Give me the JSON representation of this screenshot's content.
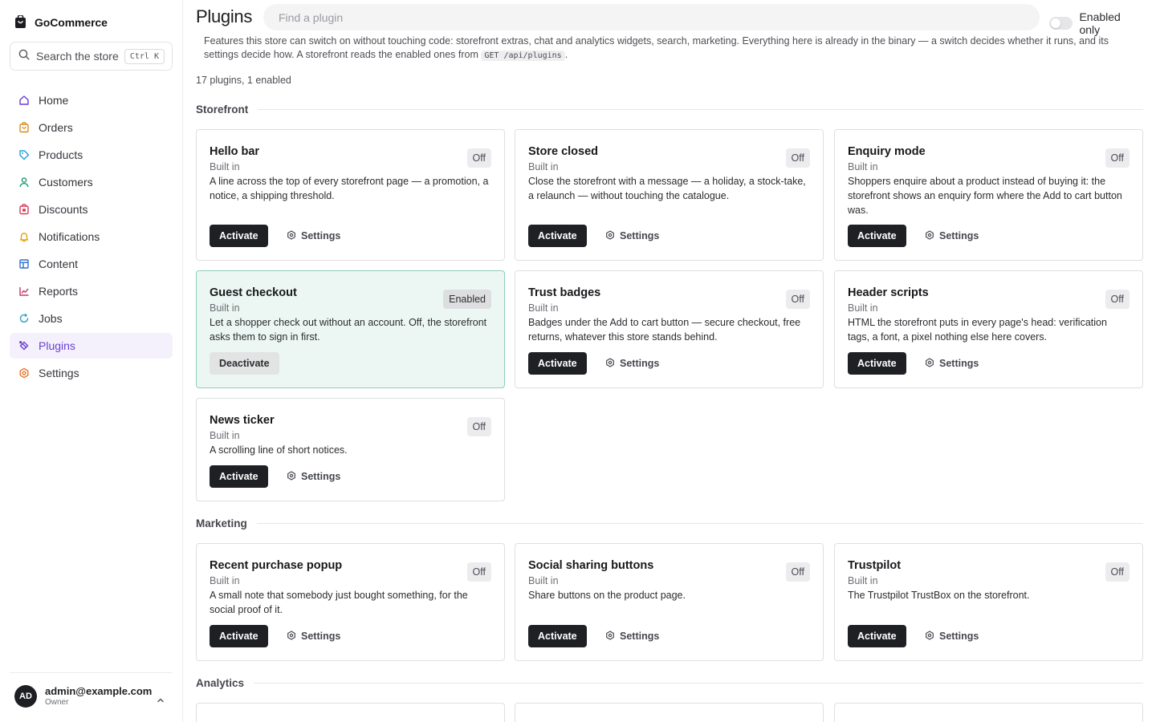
{
  "sidebar": {
    "brand": "GoCommerce",
    "search_label": "Search the store",
    "search_shortcut": "Ctrl K",
    "items": [
      {
        "label": "Home",
        "icon": "home-icon"
      },
      {
        "label": "Orders",
        "icon": "orders-icon"
      },
      {
        "label": "Products",
        "icon": "tag-icon"
      },
      {
        "label": "Customers",
        "icon": "user-icon"
      },
      {
        "label": "Discounts",
        "icon": "discount-icon"
      },
      {
        "label": "Notifications",
        "icon": "bell-icon"
      },
      {
        "label": "Content",
        "icon": "layout-icon"
      },
      {
        "label": "Reports",
        "icon": "chart-icon"
      },
      {
        "label": "Jobs",
        "icon": "refresh-icon"
      },
      {
        "label": "Plugins",
        "icon": "plug-icon",
        "active": true
      },
      {
        "label": "Settings",
        "icon": "gear-icon"
      }
    ],
    "user": {
      "initials": "AD",
      "email": "admin@example.com",
      "role": "Owner"
    }
  },
  "header": {
    "title": "Plugins",
    "search_placeholder": "Find a plugin",
    "toggle_label": "Enabled only",
    "toggle_on": false
  },
  "intro": {
    "text": "Features this store can switch on without touching code: storefront extras, chat and analytics widgets, search, marketing. Everything here is already in the binary — a switch decides whether it runs, and its settings decide how. A storefront reads the enabled ones from",
    "code": "GET /api/plugins",
    "end": "."
  },
  "count": "17 plugins, 1 enabled",
  "labels": {
    "built_in": "Built in",
    "off": "Off",
    "enabled": "Enabled",
    "activate": "Activate",
    "deactivate": "Deactivate",
    "settings": "Settings"
  },
  "colors": {
    "accent": "#6a3fd1",
    "enabled_bg": "#ecf7f3",
    "enabled_border": "#8fcfb9",
    "button_dark": "#1f2023"
  },
  "sections": [
    {
      "title": "Storefront",
      "plugins": [
        {
          "name": "Hello bar",
          "description": "A line across the top of every storefront page — a promotion, a notice, a shipping threshold.",
          "enabled": false
        },
        {
          "name": "Store closed",
          "description": "Close the storefront with a message — a holiday, a stock-take, a relaunch — without touching the catalogue.",
          "enabled": false
        },
        {
          "name": "Enquiry mode",
          "description": "Shoppers enquire about a product instead of buying it: the storefront shows an enquiry form where the Add to cart button was.",
          "enabled": false
        },
        {
          "name": "Guest checkout",
          "description": "Let a shopper check out without an account. Off, the storefront asks them to sign in first.",
          "enabled": true
        },
        {
          "name": "Trust badges",
          "description": "Badges under the Add to cart button — secure checkout, free returns, whatever this store stands behind.",
          "enabled": false
        },
        {
          "name": "Header scripts",
          "description": "HTML the storefront puts in every page's head: verification tags, a font, a pixel nothing else here covers.",
          "enabled": false
        },
        {
          "name": "News ticker",
          "description": "A scrolling line of short notices.",
          "enabled": false
        }
      ]
    },
    {
      "title": "Marketing",
      "plugins": [
        {
          "name": "Recent purchase popup",
          "description": "A small note that somebody just bought something, for the social proof of it.",
          "enabled": false
        },
        {
          "name": "Social sharing buttons",
          "description": "Share buttons on the product page.",
          "enabled": false
        },
        {
          "name": "Trustpilot",
          "description": "The Trustpilot TrustBox on the storefront.",
          "enabled": false
        }
      ]
    },
    {
      "title": "Analytics",
      "plugins": []
    }
  ]
}
